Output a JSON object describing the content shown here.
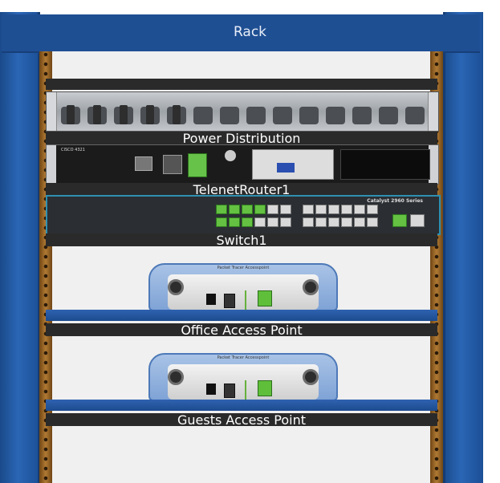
{
  "rack": {
    "title": "Rack"
  },
  "devices": [
    {
      "name": "Power Distribution"
    },
    {
      "name": "TelenetRouter1"
    },
    {
      "name": "Switch1"
    },
    {
      "name": "Office Access Point"
    },
    {
      "name": "Guests Access Point"
    }
  ],
  "router": {
    "brand": "CISCO 4321"
  },
  "switch": {
    "model": "Catalyst 2960 Series"
  },
  "access_point": {
    "title": "Packet Tracer Accesspoint"
  },
  "colors": {
    "rack_blue": "#1f4f93",
    "cable_green": "#64c142",
    "rail_brown": "#8a5a1c"
  }
}
